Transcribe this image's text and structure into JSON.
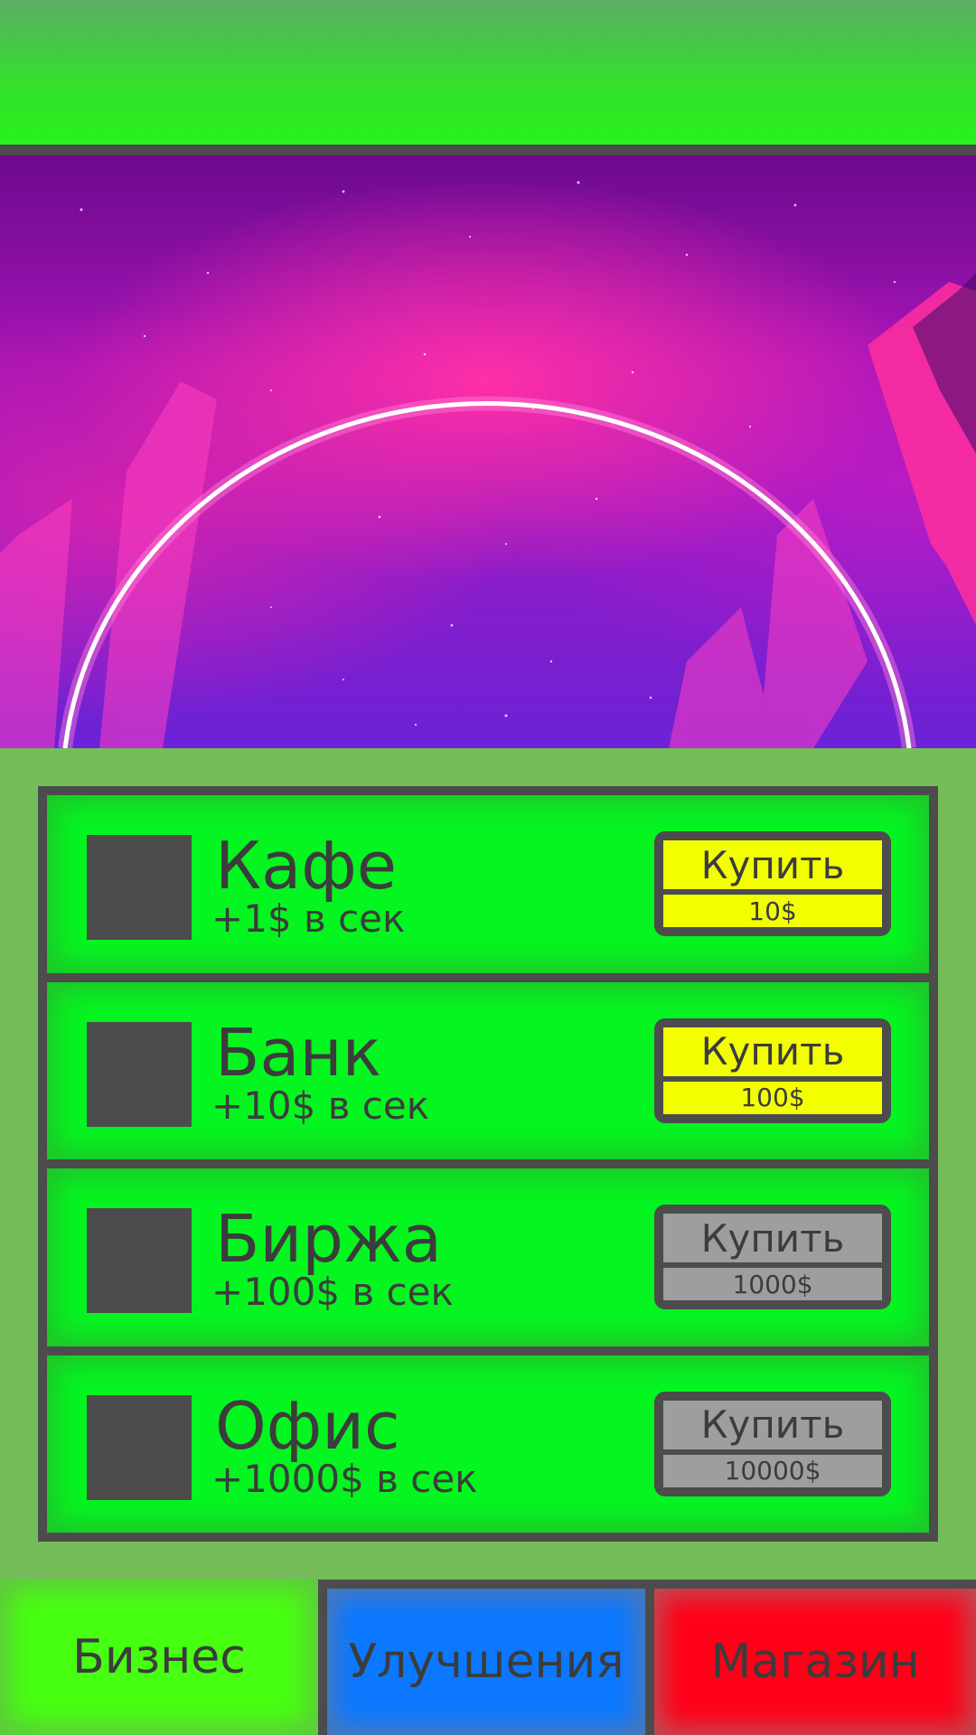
{
  "colors": {
    "background": "#74bd58",
    "header_green": "#27f21e",
    "row_green": "#05f521",
    "frame_gray": "#4c4c4c",
    "button_active": "#f3ff00",
    "button_locked": "#9e9e9e",
    "tab_business": "#47ff10",
    "tab_upgrades": "#0b78ff",
    "tab_shop": "#ff0018"
  },
  "banner": {
    "icon": "neon-ring-space-image"
  },
  "businesses": [
    {
      "title": "Кафе",
      "income": "+1$ в сек",
      "buy_label": "Купить",
      "price": "10$",
      "state": "active"
    },
    {
      "title": "Банк",
      "income": "+10$ в сек",
      "buy_label": "Купить",
      "price": "100$",
      "state": "active"
    },
    {
      "title": "Биржа",
      "income": "+100$ в сек",
      "buy_label": "Купить",
      "price": "1000$",
      "state": "locked"
    },
    {
      "title": "Офис",
      "income": "+1000$ в сек",
      "buy_label": "Купить",
      "price": "10000$",
      "state": "locked"
    }
  ],
  "nav": {
    "business": "Бизнес",
    "upgrades": "Улучшения",
    "shop": "Магазин"
  }
}
